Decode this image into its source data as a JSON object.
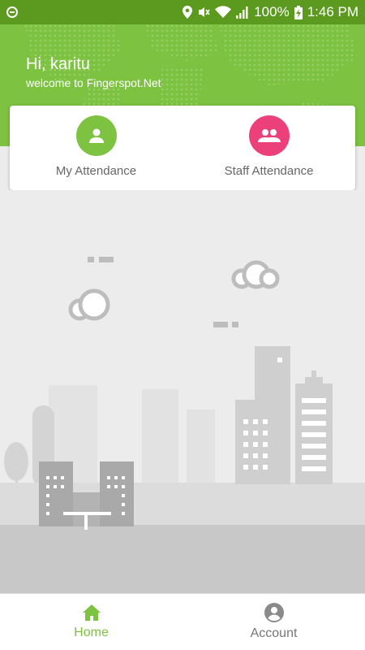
{
  "status_bar": {
    "battery": "100%",
    "time": "1:46 PM"
  },
  "header": {
    "greeting": "Hi, karitu",
    "subtitle": "welcome to Fingerspot.Net"
  },
  "menu": {
    "my_attendance": "My Attendance",
    "staff_attendance": "Staff Attendance"
  },
  "bottom_nav": {
    "home": "Home",
    "account": "Account"
  },
  "colors": {
    "primary": "#7dc241",
    "status_bar": "#5b9a1f",
    "staff_accent": "#ec407a"
  }
}
